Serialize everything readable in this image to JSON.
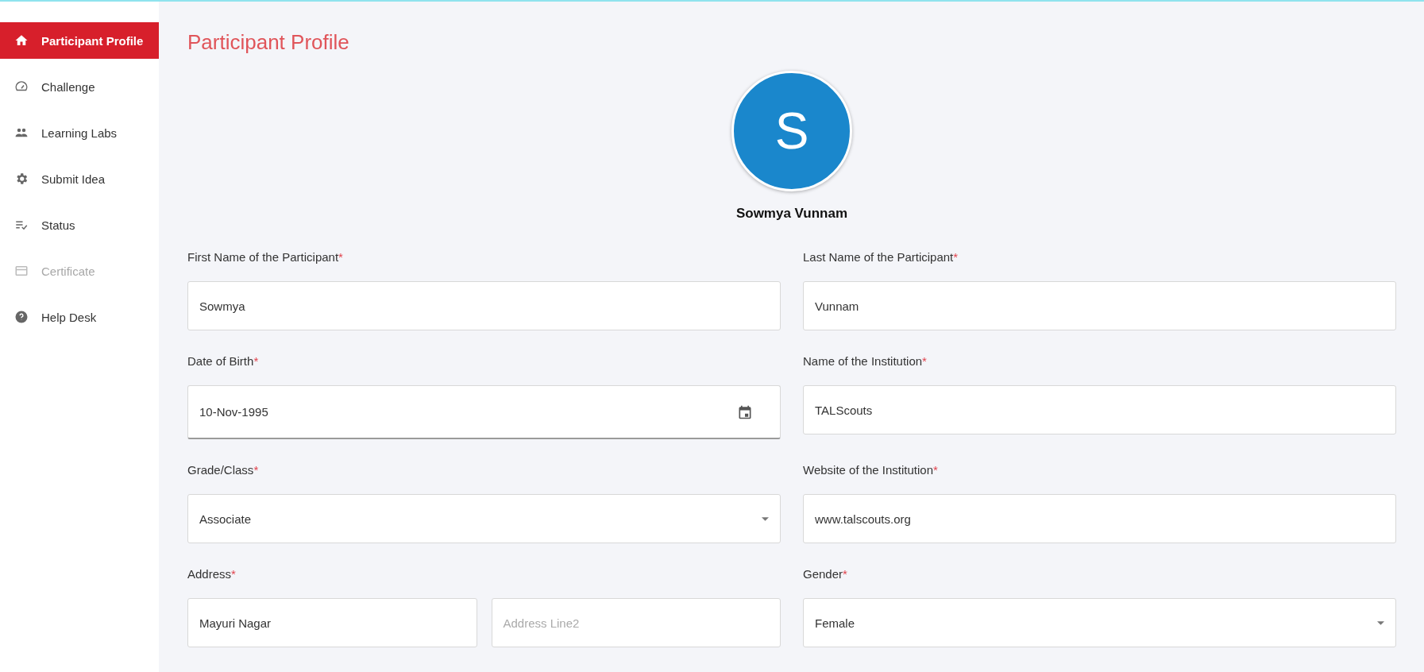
{
  "sidebar": {
    "items": [
      {
        "label": "Participant Profile",
        "kind": "home",
        "selected": true,
        "disabled": false
      },
      {
        "label": "Challenge",
        "kind": "gauge",
        "selected": false,
        "disabled": false
      },
      {
        "label": "Learning Labs",
        "kind": "people",
        "selected": false,
        "disabled": false
      },
      {
        "label": "Submit Idea",
        "kind": "gear",
        "selected": false,
        "disabled": false
      },
      {
        "label": "Status",
        "kind": "checklist",
        "selected": false,
        "disabled": false
      },
      {
        "label": "Certificate",
        "kind": "card",
        "selected": false,
        "disabled": true
      },
      {
        "label": "Help Desk",
        "kind": "help",
        "selected": false,
        "disabled": false
      }
    ]
  },
  "page": {
    "title": "Participant Profile"
  },
  "profile": {
    "initial": "S",
    "name": "Sowmya Vunnam"
  },
  "form": {
    "fields": [
      {
        "label": "First Name of the Participant",
        "required_mark": "*",
        "inputs": [
          {
            "kind": "text",
            "value": "Sowmya"
          }
        ]
      },
      {
        "label": "Last Name of the Participant",
        "required_mark": "*",
        "inputs": [
          {
            "kind": "text",
            "value": "Vunnam"
          }
        ]
      },
      {
        "label": "Date of Birth",
        "required_mark": "*",
        "inputs": [
          {
            "kind": "date",
            "value": "10-Nov-1995"
          }
        ]
      },
      {
        "label": "Name of the Institution",
        "required_mark": "*",
        "inputs": [
          {
            "kind": "text",
            "value": "TALScouts"
          }
        ]
      },
      {
        "label": "Grade/Class",
        "required_mark": "*",
        "inputs": [
          {
            "kind": "select",
            "value": "Associate"
          }
        ]
      },
      {
        "label": "Website of the Institution",
        "required_mark": "*",
        "inputs": [
          {
            "kind": "text",
            "value": "www.talscouts.org"
          }
        ]
      },
      {
        "label": "Address",
        "required_mark": "*",
        "inputs": [
          {
            "kind": "text",
            "value": "Mayuri Nagar"
          },
          {
            "kind": "text",
            "placeholder": "Address Line2"
          }
        ]
      },
      {
        "label": "Gender",
        "required_mark": "*",
        "inputs": [
          {
            "kind": "select",
            "value": "Female"
          }
        ]
      }
    ]
  }
}
